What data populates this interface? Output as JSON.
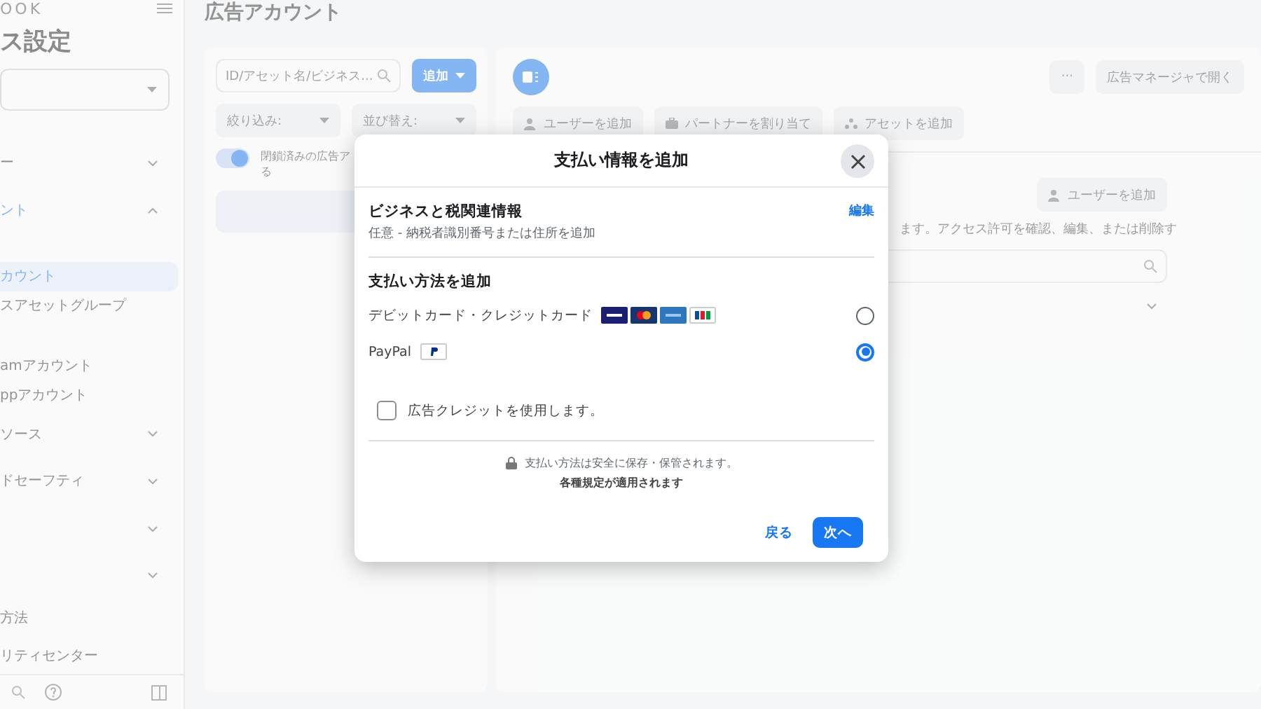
{
  "sidebar": {
    "brand": "OOK",
    "title": "ス設定",
    "items": [
      {
        "label": "ー",
        "expanded": false
      },
      {
        "label": "ント",
        "expanded": true,
        "children": [
          {
            "label": "カウント",
            "selected": true
          },
          {
            "label": "スアセットグループ",
            "selected": false
          },
          {
            "label": "amアカウント",
            "selected": false
          },
          {
            "label": "ppアカウント",
            "selected": false
          }
        ]
      },
      {
        "label": "ソース",
        "expanded": false
      },
      {
        "label": "ドセーフティ",
        "expanded": false
      },
      {
        "expanded": false
      },
      {
        "expanded": false
      },
      {
        "label": "方法"
      },
      {
        "label": "リティセンター"
      }
    ]
  },
  "page_title": "広告アカウント",
  "list_panel": {
    "search": {
      "placeholder": "ID/アセット名/ビジネス..."
    },
    "add_button": "追加",
    "filter": "絞り込み:",
    "sort": "並び替え:",
    "toggle": {
      "on": true,
      "label_lines": [
        "閉鎖済みの広告ア",
        "る"
      ]
    }
  },
  "detail_panel": {
    "more_button": "···",
    "open_button": "広告マネージャで開く",
    "actions": [
      "ユーザーを追加",
      "パートナーを割り当て",
      "アセットを追加"
    ],
    "people_button": "ユーザーを追加",
    "description": "ます。アクセス許可を確認、編集、または削除す"
  },
  "dialog": {
    "title": "支払い情報を追加",
    "business": {
      "title": "ビジネスと税関連情報",
      "subtitle": "任意 - 納税者識別番号または住所を追加",
      "edit_link": "編集"
    },
    "payment": {
      "heading": "支払い方法を追加",
      "methods": [
        {
          "kind": "card",
          "label": "デビットカード・クレジットカード",
          "selected": false
        },
        {
          "kind": "paypal",
          "label": "PayPal",
          "selected": true
        }
      ]
    },
    "ad_credit": {
      "label": "広告クレジットを使用します。",
      "checked": false
    },
    "security_note": "支払い方法は安全に保存・保管されます。",
    "terms": "各種規定が適用されます",
    "back_button": "戻る",
    "next_button": "次へ"
  }
}
